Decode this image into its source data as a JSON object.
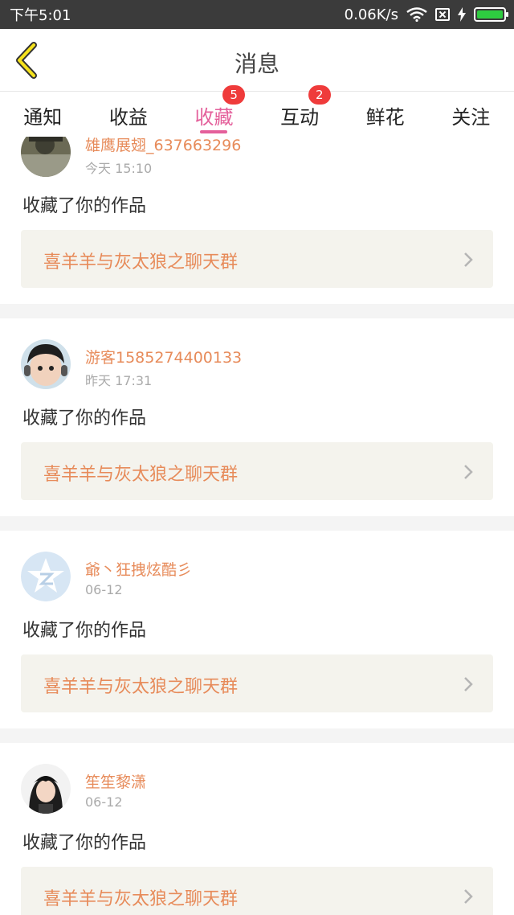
{
  "status_bar": {
    "time": "下午5:01",
    "network_speed": "0.06K/s",
    "icons": [
      "wifi-icon",
      "sim-icon",
      "bolt-icon",
      "battery-icon"
    ],
    "battery_level": 1.0
  },
  "header": {
    "title": "消息",
    "back_icon": "chevron-left-icon"
  },
  "tabs": [
    {
      "label": "通知",
      "badge": ""
    },
    {
      "label": "收益",
      "badge": ""
    },
    {
      "label": "收藏",
      "badge": "5",
      "active": true
    },
    {
      "label": "互动",
      "badge": "2"
    },
    {
      "label": "鲜花",
      "badge": ""
    },
    {
      "label": "关注",
      "badge": ""
    }
  ],
  "colors": {
    "accent": "#e4609b",
    "name": "#e78b5a",
    "badge": "#ef3b3b"
  },
  "feed": [
    {
      "username": "雄鹰展翅_637663296",
      "time": "今天 15:10",
      "action": "收藏了你的作品",
      "work": "喜羊羊与灰太狼之聊天群",
      "avatar": "photo-avatar"
    },
    {
      "username": "游客1585274400133",
      "time": "昨天 17:31",
      "action": "收藏了你的作品",
      "work": "喜羊羊与灰太狼之聊天群",
      "avatar": "child-avatar"
    },
    {
      "username": "爺丶狂拽炫酷彡",
      "time": "06-12",
      "action": "收藏了你的作品",
      "work": "喜羊羊与灰太狼之聊天群",
      "avatar": "default-star-avatar"
    },
    {
      "username": "笙笙黎潇",
      "time": "06-12",
      "action": "收藏了你的作品",
      "work": "喜羊羊与灰太狼之聊天群",
      "avatar": "girl-avatar"
    }
  ]
}
